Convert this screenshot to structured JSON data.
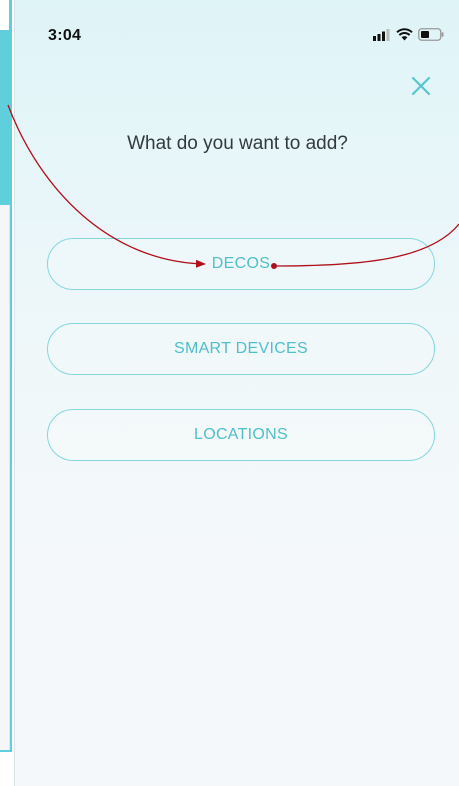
{
  "status_bar": {
    "time": "3:04",
    "icons": [
      "signal-icon",
      "wifi-icon",
      "battery-icon"
    ]
  },
  "dialog": {
    "close_icon": "close-icon",
    "title": "What do you want to add?",
    "options": [
      {
        "label": "DECOS"
      },
      {
        "label": "SMART DEVICES"
      },
      {
        "label": "LOCATIONS"
      }
    ]
  },
  "colors": {
    "accent": "#4fbfcc",
    "button_border": "#86d6df",
    "annotation_arrow": "#b0101a",
    "side_band": "#5fcfdc"
  }
}
